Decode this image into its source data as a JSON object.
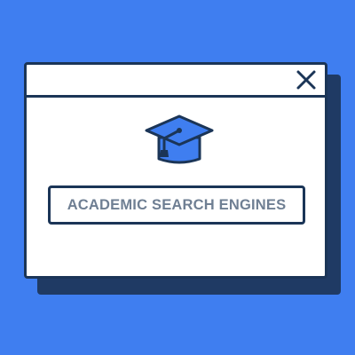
{
  "colors": {
    "background": "#3f7ef0",
    "outline": "#1b3557",
    "shadow": "#1f3a64",
    "window": "#ffffff",
    "cap": "#3f7ef0",
    "search_text": "#6f7f93"
  },
  "window": {
    "close_icon": "close-x-icon",
    "hero_icon": "graduation-cap-icon"
  },
  "search": {
    "text": "ACADEMIC SEARCH ENGINES"
  }
}
